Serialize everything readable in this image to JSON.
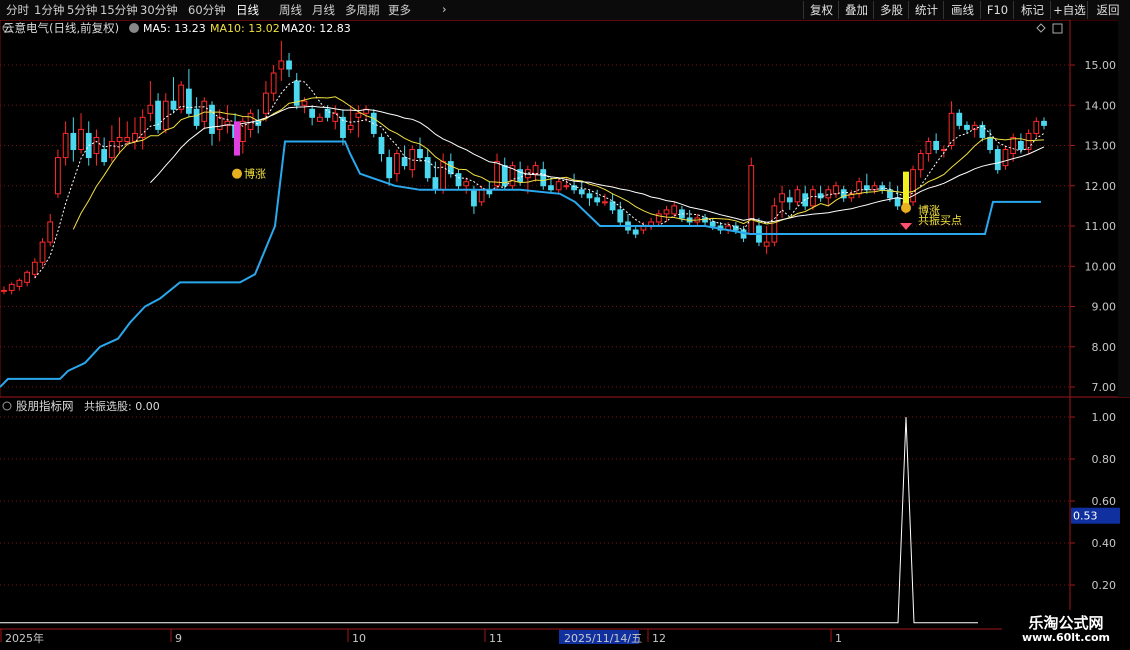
{
  "toolbar": {
    "timeframes": [
      "分时",
      "1分钟",
      "5分钟",
      "15分钟",
      "30分钟",
      "60分钟",
      "日线",
      "周线",
      "月线",
      "多周期",
      "更多"
    ],
    "active_timeframe": "日线",
    "buttons": [
      "复权",
      "叠加",
      "多股",
      "统计",
      "画线",
      "F10",
      "标记",
      "+自选",
      "返回"
    ]
  },
  "main_panel": {
    "stock_title": "云意电气(日线,前复权)",
    "ma5_label": "MA5: 13.23",
    "ma10_label": "MA10: 13.02",
    "ma20_label": "MA20: 12.83",
    "signal_bozhang": "博涨",
    "signal_bozhang2": "博涨",
    "signal_gongzhen": "共振买点",
    "y_ticks": [
      "15.00",
      "14.00",
      "13.00",
      "12.00",
      "11.00",
      "10.00",
      "9.00",
      "8.00",
      "7.00"
    ]
  },
  "sub_panel": {
    "title": "股朋指标网",
    "indicator_label": "共振选股: 0.00",
    "y_ticks": [
      "1.00",
      "0.80",
      "0.60",
      "0.40",
      "0.20"
    ],
    "current_value": "0.53"
  },
  "x_axis": {
    "labels": [
      "2025年",
      "9",
      "10",
      "11",
      "2025/11/14/五",
      "12",
      "1"
    ]
  },
  "logo": {
    "name": "乐淘公式网",
    "url": "www.60lt.com"
  },
  "colors": {
    "up": "#ff2a2a",
    "down": "#4cd8ee",
    "ma5": "#ffffff",
    "ma10": "#f0e040",
    "support": "#2aa8ee",
    "grid": "#7a1010"
  },
  "chart_data": {
    "type": "candlestick",
    "price_range": [
      7.0,
      15.5
    ],
    "ohlc_approx": [
      [
        9.4,
        9.5,
        9.3,
        9.4
      ],
      [
        9.4,
        9.6,
        9.3,
        9.55
      ],
      [
        9.5,
        9.7,
        9.4,
        9.65
      ],
      [
        9.6,
        9.9,
        9.5,
        9.85
      ],
      [
        9.8,
        10.2,
        9.7,
        10.1
      ],
      [
        10.1,
        10.7,
        10.0,
        10.6
      ],
      [
        10.6,
        11.3,
        10.5,
        11.1
      ],
      [
        11.8,
        12.9,
        11.7,
        12.7
      ],
      [
        12.7,
        13.6,
        12.5,
        13.3
      ],
      [
        13.3,
        13.7,
        12.6,
        12.9
      ],
      [
        12.9,
        13.8,
        12.8,
        13.4
      ],
      [
        13.3,
        13.6,
        12.5,
        12.7
      ],
      [
        12.8,
        13.4,
        12.5,
        13.2
      ],
      [
        12.9,
        13.2,
        12.5,
        12.6
      ],
      [
        12.7,
        13.5,
        12.6,
        13.1
      ],
      [
        13.1,
        13.7,
        12.8,
        13.2
      ],
      [
        13.1,
        13.6,
        13.0,
        13.2
      ],
      [
        13.1,
        13.7,
        12.9,
        13.3
      ],
      [
        13.2,
        13.9,
        12.9,
        13.7
      ],
      [
        13.8,
        14.6,
        13.6,
        14.0
      ],
      [
        14.1,
        14.3,
        13.3,
        13.4
      ],
      [
        13.4,
        14.3,
        13.3,
        14.1
      ],
      [
        14.1,
        14.7,
        13.8,
        13.9
      ],
      [
        13.9,
        14.6,
        13.8,
        14.5
      ],
      [
        14.4,
        14.9,
        13.7,
        13.8
      ],
      [
        13.9,
        14.2,
        13.4,
        13.5
      ],
      [
        13.6,
        14.2,
        13.4,
        14.1
      ],
      [
        14.0,
        14.1,
        13.0,
        13.3
      ],
      [
        13.4,
        13.9,
        13.1,
        13.7
      ],
      [
        13.5,
        14.0,
        13.3,
        13.6
      ],
      [
        13.5,
        13.8,
        13.0,
        13.2
      ],
      [
        13.1,
        13.7,
        12.8,
        13.6
      ],
      [
        13.4,
        13.9,
        13.2,
        13.8
      ],
      [
        13.6,
        13.9,
        13.3,
        13.5
      ],
      [
        13.8,
        14.6,
        13.6,
        14.3
      ],
      [
        14.3,
        15.0,
        14.1,
        14.8
      ],
      [
        14.9,
        15.6,
        14.6,
        15.1
      ],
      [
        15.1,
        15.3,
        14.7,
        14.9
      ],
      [
        14.6,
        14.8,
        13.9,
        14.0
      ],
      [
        14.0,
        14.2,
        13.8,
        14.1
      ],
      [
        13.9,
        14.0,
        13.5,
        13.7
      ],
      [
        13.6,
        13.8,
        13.6,
        13.7
      ],
      [
        13.9,
        14.0,
        13.6,
        13.7
      ],
      [
        13.6,
        14.0,
        13.4,
        13.8
      ],
      [
        13.7,
        13.9,
        13.0,
        13.2
      ],
      [
        13.4,
        14.0,
        13.3,
        13.5
      ],
      [
        13.7,
        14.0,
        13.2,
        13.8
      ],
      [
        13.8,
        14.0,
        13.6,
        13.9
      ],
      [
        13.8,
        13.9,
        13.2,
        13.3
      ],
      [
        13.2,
        13.3,
        12.6,
        12.8
      ],
      [
        12.7,
        12.9,
        12.0,
        12.2
      ],
      [
        12.3,
        12.9,
        12.1,
        12.8
      ],
      [
        12.7,
        13.0,
        12.4,
        12.5
      ],
      [
        12.4,
        13.0,
        12.2,
        12.9
      ],
      [
        12.9,
        13.2,
        12.6,
        12.7
      ],
      [
        12.7,
        12.9,
        12.1,
        12.2
      ],
      [
        12.2,
        12.6,
        11.8,
        11.9
      ],
      [
        11.9,
        12.8,
        11.8,
        12.6
      ],
      [
        12.6,
        12.8,
        12.2,
        12.3
      ],
      [
        12.3,
        12.4,
        11.9,
        12.0
      ],
      [
        12.0,
        12.2,
        11.8,
        12.1
      ],
      [
        11.9,
        12.0,
        11.3,
        11.5
      ],
      [
        11.6,
        12.0,
        11.5,
        11.9
      ],
      [
        11.9,
        12.1,
        11.7,
        11.8
      ],
      [
        12.0,
        12.8,
        11.9,
        12.6
      ],
      [
        12.5,
        12.7,
        11.9,
        12.0
      ],
      [
        12.0,
        12.6,
        11.9,
        12.5
      ],
      [
        12.4,
        12.6,
        12.0,
        12.1
      ],
      [
        12.2,
        12.5,
        11.8,
        12.4
      ],
      [
        12.3,
        12.6,
        12.1,
        12.5
      ],
      [
        12.4,
        12.6,
        11.9,
        12.0
      ],
      [
        12.0,
        12.2,
        11.8,
        11.9
      ],
      [
        11.9,
        12.2,
        11.8,
        12.1
      ],
      [
        12.0,
        12.2,
        11.9,
        12.0
      ],
      [
        12.0,
        12.3,
        11.8,
        11.9
      ],
      [
        11.9,
        12.1,
        11.7,
        11.8
      ],
      [
        11.8,
        11.9,
        11.5,
        11.7
      ],
      [
        11.7,
        11.9,
        11.5,
        11.6
      ],
      [
        11.6,
        11.8,
        11.5,
        11.6
      ],
      [
        11.6,
        11.8,
        11.3,
        11.4
      ],
      [
        11.4,
        11.6,
        11.0,
        11.1
      ],
      [
        11.1,
        11.3,
        10.8,
        10.9
      ],
      [
        10.9,
        11.0,
        10.7,
        10.8
      ],
      [
        10.9,
        11.1,
        10.8,
        11.0
      ],
      [
        11.0,
        11.2,
        10.9,
        11.1
      ],
      [
        11.1,
        11.4,
        11.0,
        11.3
      ],
      [
        11.3,
        11.5,
        11.1,
        11.4
      ],
      [
        11.3,
        11.6,
        11.2,
        11.5
      ],
      [
        11.4,
        11.5,
        11.1,
        11.2
      ],
      [
        11.2,
        11.4,
        11.0,
        11.1
      ],
      [
        11.1,
        11.3,
        11.0,
        11.2
      ],
      [
        11.2,
        11.3,
        11.0,
        11.1
      ],
      [
        11.1,
        11.2,
        10.9,
        11.0
      ],
      [
        11.0,
        11.1,
        10.8,
        10.9
      ],
      [
        10.9,
        11.1,
        10.8,
        11.0
      ],
      [
        11.0,
        11.1,
        10.8,
        10.9
      ],
      [
        10.9,
        11.0,
        10.6,
        10.7
      ],
      [
        10.8,
        12.7,
        10.8,
        12.5
      ],
      [
        11.0,
        11.2,
        10.5,
        10.6
      ],
      [
        10.5,
        11.0,
        10.3,
        10.6
      ],
      [
        10.6,
        11.7,
        10.5,
        11.5
      ],
      [
        11.6,
        12.0,
        11.2,
        11.8
      ],
      [
        11.7,
        11.9,
        11.4,
        11.6
      ],
      [
        11.6,
        12.0,
        11.5,
        11.9
      ],
      [
        11.8,
        12.0,
        11.4,
        11.5
      ],
      [
        11.5,
        12.0,
        11.4,
        11.9
      ],
      [
        11.8,
        12.0,
        11.6,
        11.7
      ],
      [
        11.7,
        12.0,
        11.5,
        11.9
      ],
      [
        11.8,
        12.1,
        11.7,
        12.0
      ],
      [
        11.9,
        12.0,
        11.6,
        11.7
      ],
      [
        11.7,
        11.9,
        11.6,
        11.8
      ],
      [
        11.8,
        12.2,
        11.7,
        12.1
      ],
      [
        12.0,
        12.3,
        11.8,
        11.9
      ],
      [
        11.9,
        12.1,
        11.8,
        12.0
      ],
      [
        12.0,
        12.1,
        11.8,
        11.9
      ],
      [
        11.9,
        12.1,
        11.6,
        11.7
      ],
      [
        11.7,
        12.0,
        11.4,
        11.5
      ],
      [
        11.5,
        11.7,
        11.3,
        11.6
      ],
      [
        11.6,
        12.5,
        11.5,
        12.4
      ],
      [
        12.4,
        12.9,
        12.2,
        12.8
      ],
      [
        12.8,
        13.2,
        12.6,
        13.1
      ],
      [
        13.1,
        13.3,
        12.8,
        12.9
      ],
      [
        12.9,
        13.0,
        12.7,
        12.9
      ],
      [
        13.0,
        14.1,
        12.9,
        13.8
      ],
      [
        13.8,
        13.9,
        13.4,
        13.5
      ],
      [
        13.5,
        13.6,
        13.3,
        13.4
      ],
      [
        13.4,
        13.6,
        13.2,
        13.5
      ],
      [
        13.5,
        13.6,
        13.1,
        13.2
      ],
      [
        13.2,
        13.4,
        12.8,
        12.9
      ],
      [
        12.9,
        13.0,
        12.3,
        12.4
      ],
      [
        12.5,
        13.0,
        12.4,
        12.9
      ],
      [
        12.8,
        13.3,
        12.6,
        13.2
      ],
      [
        13.1,
        13.3,
        12.8,
        12.9
      ],
      [
        12.9,
        13.4,
        12.8,
        13.3
      ],
      [
        13.3,
        13.7,
        13.2,
        13.6
      ],
      [
        13.6,
        13.7,
        13.4,
        13.5
      ]
    ],
    "indicator_series_name": "共振选股",
    "indicator_range": [
      0,
      1.1
    ]
  }
}
